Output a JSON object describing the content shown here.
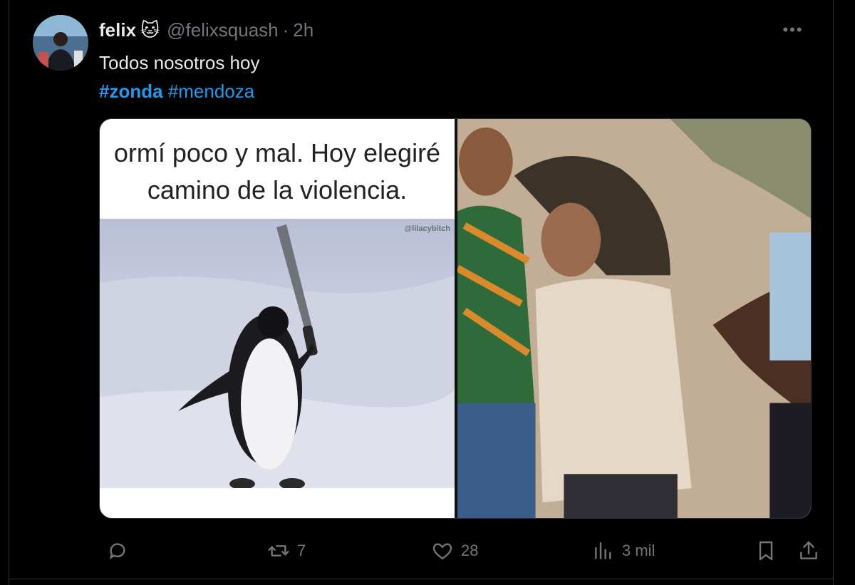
{
  "tweet": {
    "name": "felix",
    "name_emoji": "🐱",
    "handle": "@felixsquash",
    "separator": "·",
    "time": "2h",
    "text": "Todos nosotros hoy",
    "hashtags": [
      "#zonda",
      "#mendoza"
    ],
    "more_label": "•••"
  },
  "media": {
    "meme_caption_line1": "ormí poco y mal. Hoy elegiré",
    "meme_caption_line2": "camino de la violencia.",
    "meme_watermark": "@lilacybitch"
  },
  "actions": {
    "reply_icon": "reply-icon",
    "retweet_icon": "retweet-icon",
    "retweet_count": "7",
    "like_icon": "heart-icon",
    "like_count": "28",
    "views_icon": "views-icon",
    "views_count": "3 mil",
    "bookmark_icon": "bookmark-icon",
    "share_icon": "share-icon"
  },
  "colors": {
    "background": "#000000",
    "text": "#e7e9ea",
    "muted": "#71767b",
    "link": "#1d9bf0",
    "border": "#2f3336"
  }
}
